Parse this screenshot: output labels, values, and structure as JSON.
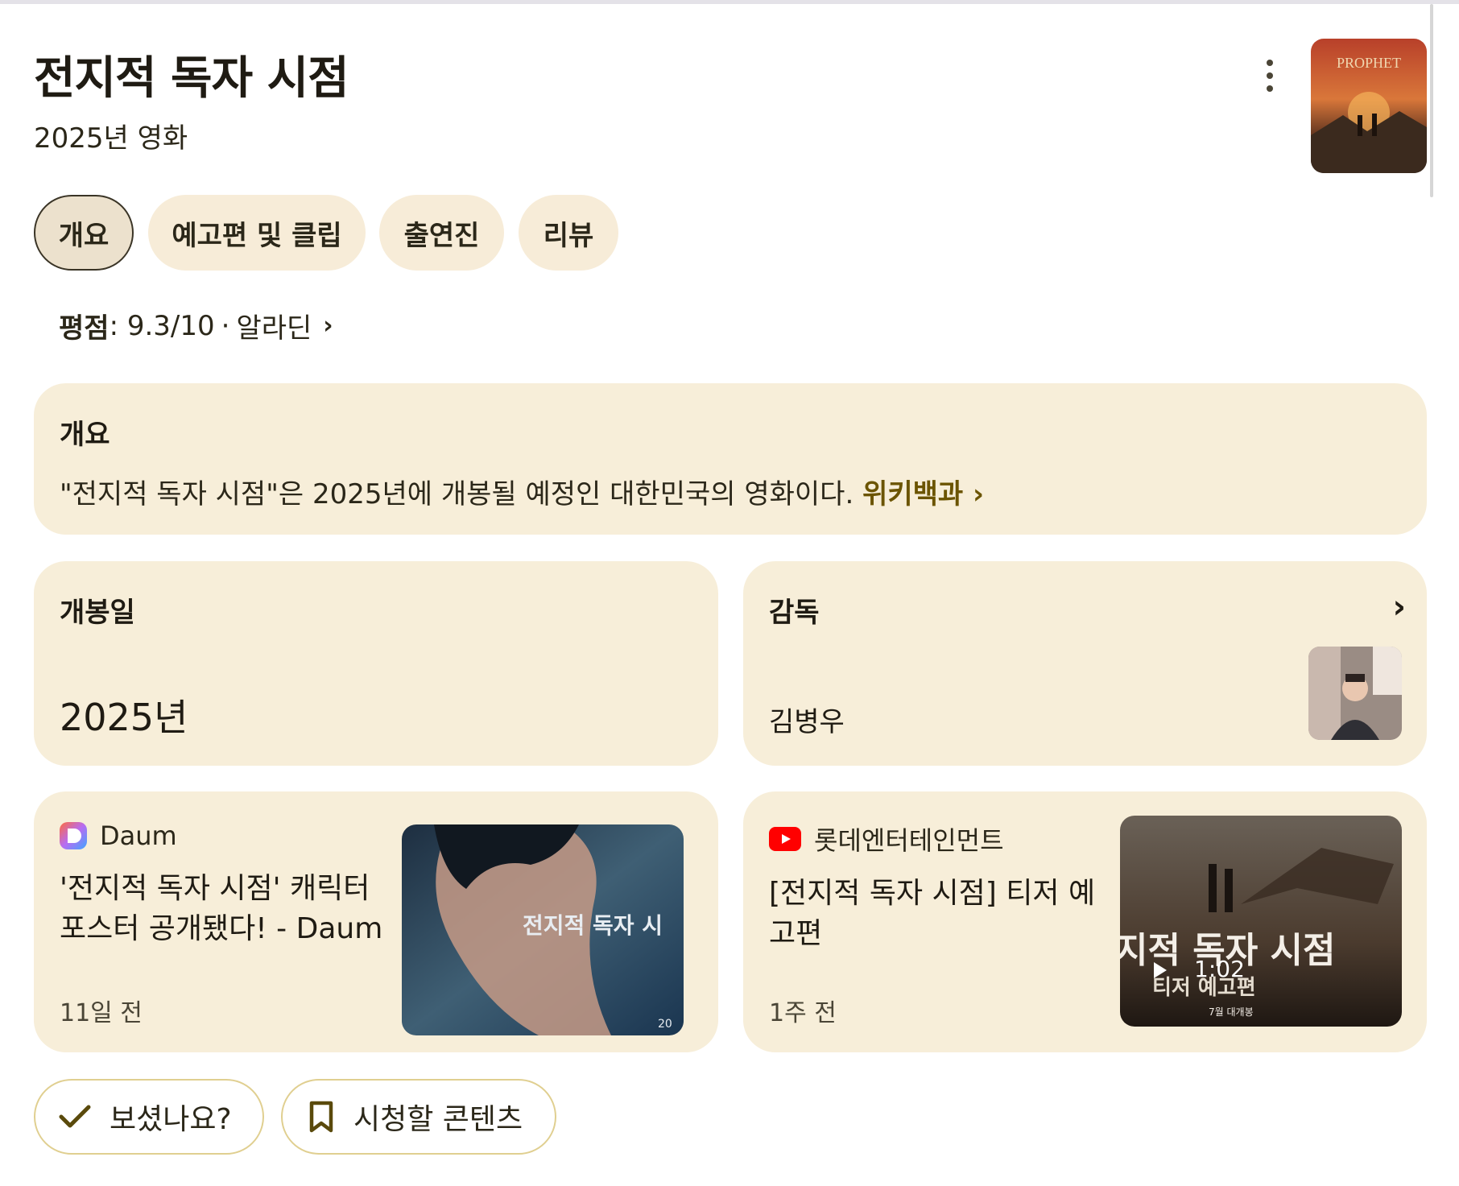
{
  "header": {
    "title": "전지적 독자 시점",
    "subtitle": "2025년 영화",
    "more_icon": "more-vert-icon",
    "poster_text": "PROPHET"
  },
  "tabs": [
    {
      "label": "개요",
      "active": true
    },
    {
      "label": "예고편 및 클립",
      "active": false
    },
    {
      "label": "출연진",
      "active": false
    },
    {
      "label": "리뷰",
      "active": false
    }
  ],
  "rating": {
    "label": "평점",
    "value": ": 9.3/10",
    "separator": "·",
    "source": "알라딘"
  },
  "overview": {
    "heading": "개요",
    "text": "\"전지적 독자 시점\"은 2025년에 개봉될 예정인 대한민국의 영화이다.",
    "link": "위키백과"
  },
  "release": {
    "heading": "개봉일",
    "value": "2025년"
  },
  "director": {
    "heading": "감독",
    "name": "김병우"
  },
  "news": [
    {
      "source": "Daum",
      "headline": "'전지적 독자 시점' 캐릭터 포스터 공개됐다! - Daum",
      "time": "11일 전",
      "image_text": "전지적 독자 시",
      "image_footer": "20"
    },
    {
      "source": "롯데엔터테인먼트",
      "headline": "[전지적 독자 시점] 티저 예고편",
      "time": "1주 전",
      "image_text": "지적 독자 시점",
      "image_sub": "티저 예고편",
      "image_footer": "7월 대개봉",
      "duration": "1:02"
    }
  ],
  "actions": {
    "watched": "보셨나요?",
    "watchlist": "시청할 콘텐츠"
  },
  "colors": {
    "card_bg": "#f7eed9",
    "chip_bg": "#f7ecd8",
    "link": "#6b5400",
    "button_border": "#e0cf90"
  }
}
